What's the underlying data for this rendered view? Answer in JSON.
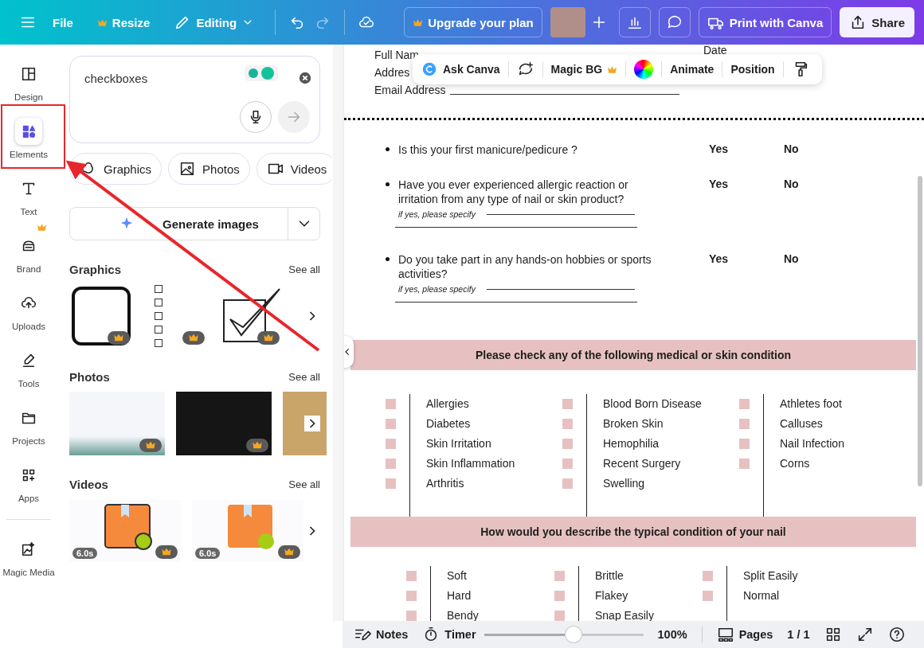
{
  "topbar": {
    "file": "File",
    "resize": "Resize",
    "editing": "Editing",
    "upgrade": "Upgrade your plan",
    "print": "Print with Canva",
    "share": "Share"
  },
  "rail": [
    {
      "label": "Design",
      "selected": false,
      "crown": false
    },
    {
      "label": "Elements",
      "selected": true,
      "crown": false
    },
    {
      "label": "Text",
      "selected": false,
      "crown": false
    },
    {
      "label": "Brand",
      "selected": false,
      "crown": true
    },
    {
      "label": "Uploads",
      "selected": false,
      "crown": false
    },
    {
      "label": "Tools",
      "selected": false,
      "crown": false
    },
    {
      "label": "Projects",
      "selected": false,
      "crown": false
    },
    {
      "label": "Apps",
      "selected": false,
      "crown": false
    },
    {
      "label": "Magic Media",
      "selected": false,
      "crown": false
    }
  ],
  "search": {
    "value": "checkboxes"
  },
  "chips": [
    "Graphics",
    "Photos",
    "Videos"
  ],
  "generate": "Generate images",
  "sections": [
    {
      "title": "Graphics",
      "see_all": "See all"
    },
    {
      "title": "Photos",
      "see_all": "See all"
    },
    {
      "title": "Videos",
      "see_all": "See all"
    }
  ],
  "videos": [
    {
      "duration": "6.0s"
    },
    {
      "duration": "6.0s"
    }
  ],
  "document": {
    "header": {
      "full_name": "Full Nam",
      "address": "Addres",
      "email": "Email Address",
      "date": "Date"
    },
    "toolbar": {
      "ask": "Ask Canva",
      "magic_bg": "Magic BG",
      "animate": "Animate",
      "position": "Position"
    },
    "questions": [
      {
        "text": "Is this your first manicure/pedicure ?",
        "yes": "Yes",
        "no": "No"
      },
      {
        "text": "Have you ever experienced allergic reaction or irritation from any type of nail or skin product?",
        "yes": "Yes",
        "no": "No",
        "specify": "if yes, please specify"
      },
      {
        "text": "Do you take part in any hands-on hobbies or sports activities?",
        "yes": "Yes",
        "no": "No",
        "specify": "if yes, please specify"
      }
    ],
    "conditions": {
      "title": "Please check any of the following medical or skin condition",
      "columns": [
        [
          {
            "label": "Allergies",
            "checked": false
          },
          {
            "label": "Diabetes",
            "checked": false
          },
          {
            "label": "Skin Irritation",
            "checked": false
          },
          {
            "label": "Skin Inflammation",
            "checked": false
          },
          {
            "label": "Arthritis",
            "checked": false
          }
        ],
        [
          {
            "label": "Blood Born Disease",
            "checked": false
          },
          {
            "label": "Broken Skin",
            "checked": false
          },
          {
            "label": "Hemophilia",
            "checked": false
          },
          {
            "label": "Recent Surgery",
            "checked": false
          },
          {
            "label": "Swelling",
            "checked": false
          }
        ],
        [
          {
            "label": "Athletes foot",
            "checked": false
          },
          {
            "label": "Calluses",
            "checked": false
          },
          {
            "label": "Nail Infection",
            "checked": false
          },
          {
            "label": "Corns",
            "checked": false
          }
        ]
      ]
    },
    "nails": {
      "title": "How would you describe the typical condition of your nail",
      "columns": [
        [
          {
            "label": "Soft",
            "checked": false
          },
          {
            "label": "Hard",
            "checked": false
          },
          {
            "label": "Bendy",
            "checked": false
          }
        ],
        [
          {
            "label": "Brittle",
            "checked": false
          },
          {
            "label": "Flakey",
            "checked": false
          },
          {
            "label": "Snap Easily",
            "checked": false
          }
        ],
        [
          {
            "label": "Split Easily",
            "checked": false
          },
          {
            "label": "Normal",
            "checked": false
          }
        ]
      ]
    }
  },
  "bottombar": {
    "notes": "Notes",
    "timer": "Timer",
    "zoom": {
      "level": 0.57
    },
    "zoom_text": "100%",
    "pages": "Pages",
    "page_count": "1 / 1"
  }
}
